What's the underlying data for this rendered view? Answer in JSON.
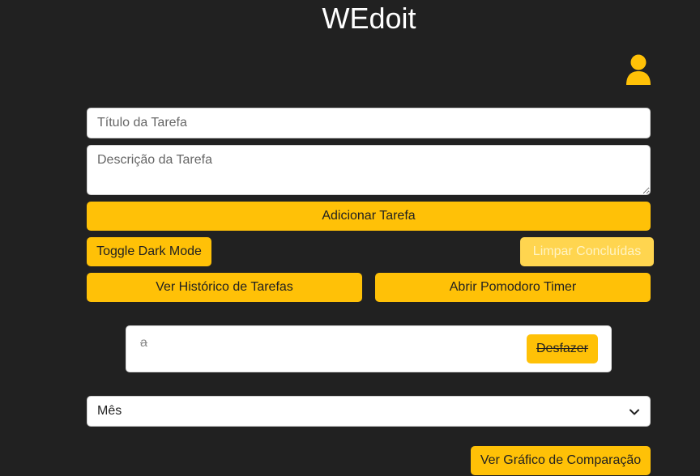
{
  "app": {
    "title": "WEdoit"
  },
  "form": {
    "title_placeholder": "Título da Tarefa",
    "title_value": "",
    "description_placeholder": "Descrição da Tarefa",
    "description_value": "",
    "add_label": "Adicionar Tarefa"
  },
  "controls": {
    "dark_mode_label": "Toggle Dark Mode",
    "clear_completed_label": "Limpar Concluídas",
    "history_label": "Ver Histórico de Tarefas",
    "pomodoro_label": "Abrir Pomodoro Timer"
  },
  "tasks": [
    {
      "text": "a",
      "completed": true,
      "undo_label": "Desfazer"
    }
  ],
  "period_select": {
    "selected": "Mês"
  },
  "chart_button_label": "Ver Gráfico de Comparação",
  "colors": {
    "background": "#212121",
    "accent": "#ffc107",
    "accent_disabled": "#ffd54f",
    "text_light": "#ffffff"
  },
  "icons": {
    "user": "user-icon",
    "select": "chevron-down-icon"
  }
}
